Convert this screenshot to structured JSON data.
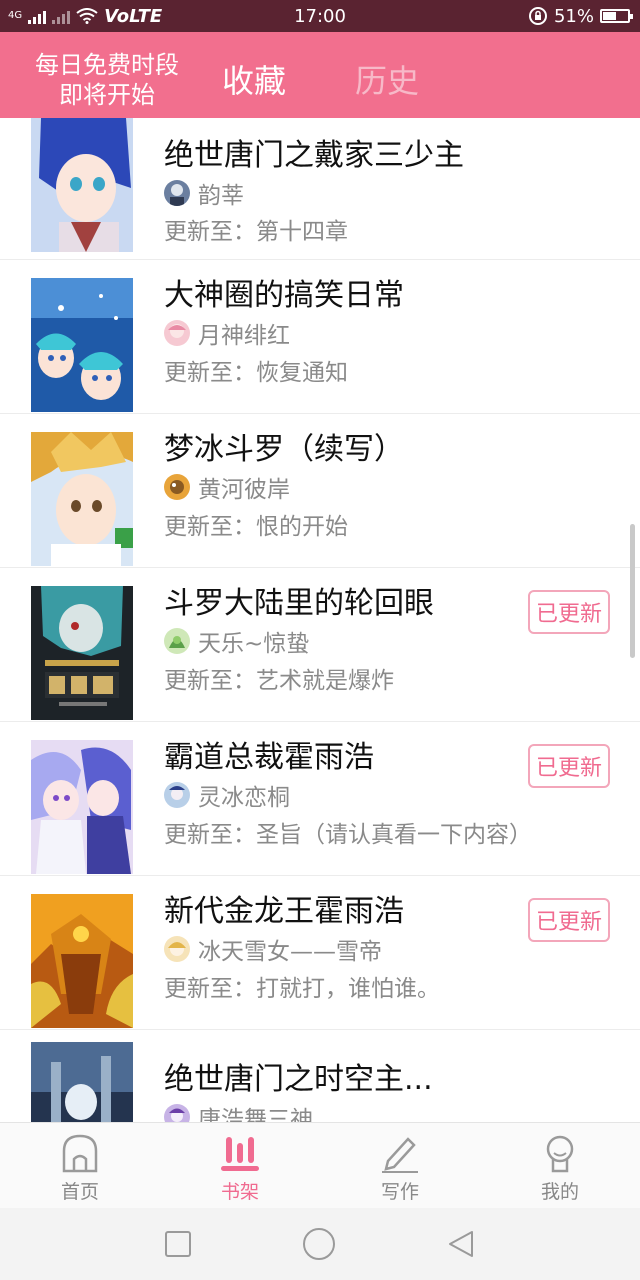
{
  "statusbar": {
    "network_left": "4G",
    "carrier": "VoLTE",
    "time": "17:00",
    "battery": "51%",
    "battery_level": 0.51
  },
  "header": {
    "free_time_line1": "每日免费时段",
    "free_time_line2": "即将开始",
    "tabs": [
      {
        "label": "收藏",
        "active": true
      },
      {
        "label": "历史",
        "active": false
      }
    ]
  },
  "colors": {
    "accent": "#f26f8e",
    "statusbar": "#5a2331",
    "badge_text": "#f06b90",
    "muted_text": "#8a8a8a"
  },
  "books": [
    {
      "title": "绝世唐门之戴家三少主",
      "author": "韵莘",
      "update": "更新至：第十四章",
      "badge": ""
    },
    {
      "title": "大神圈的搞笑日常",
      "author": "月神绯红",
      "update": "更新至：恢复通知",
      "badge": ""
    },
    {
      "title": "梦冰斗罗（续写）",
      "author": "黄河彼岸",
      "update": "更新至：恨的开始",
      "badge": ""
    },
    {
      "title": "斗罗大陆里的轮回眼",
      "author": "天乐~惊蛰",
      "update": "更新至：艺术就是爆炸",
      "badge": "已更新"
    },
    {
      "title": "霸道总裁霍雨浩",
      "author": "灵冰恋桐",
      "update": "更新至：圣旨（请认真看一下内容）",
      "badge": "已更新"
    },
    {
      "title": "新代金龙王霍雨浩",
      "author": "冰天雪女——雪帝",
      "update": "更新至：打就打，谁怕谁。",
      "badge": "已更新"
    },
    {
      "title": "绝世唐门之时空主...",
      "author": "唐浩舞三神",
      "update": "",
      "badge": ""
    }
  ],
  "bottomnav": [
    {
      "label": "首页",
      "icon": "home-icon",
      "active": false
    },
    {
      "label": "书架",
      "icon": "bookshelf-icon",
      "active": true
    },
    {
      "label": "写作",
      "icon": "pen-icon",
      "active": false
    },
    {
      "label": "我的",
      "icon": "profile-icon",
      "active": false
    }
  ],
  "system_nav": [
    "recents-icon",
    "home-circle-icon",
    "back-icon"
  ]
}
